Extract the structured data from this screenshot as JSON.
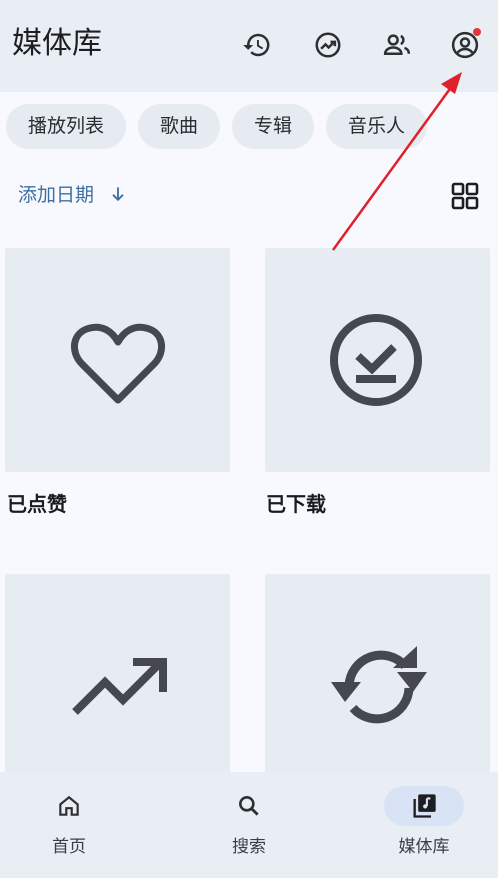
{
  "header": {
    "title": "媒体库",
    "icons": [
      "history-icon",
      "insights-icon",
      "people-icon",
      "account-icon"
    ],
    "notification_color": "#e53935"
  },
  "chips": [
    "播放列表",
    "歌曲",
    "专辑",
    "音乐人"
  ],
  "sort": {
    "label": "添加日期",
    "direction_icon": "arrow-down-icon"
  },
  "cards": [
    {
      "label": "已点赞",
      "icon": "heart-icon"
    },
    {
      "label": "已下载",
      "icon": "downloaded-icon"
    },
    {
      "label": "",
      "icon": "trending-icon"
    },
    {
      "label": "",
      "icon": "sync-icon"
    }
  ],
  "nav": [
    {
      "label": "首页",
      "icon": "home-icon"
    },
    {
      "label": "搜索",
      "icon": "search-icon"
    },
    {
      "label": "媒体库",
      "icon": "library-icon",
      "active": true
    }
  ],
  "colors": {
    "accent": "#3f6ea3",
    "annotation_arrow": "#e0202a"
  }
}
